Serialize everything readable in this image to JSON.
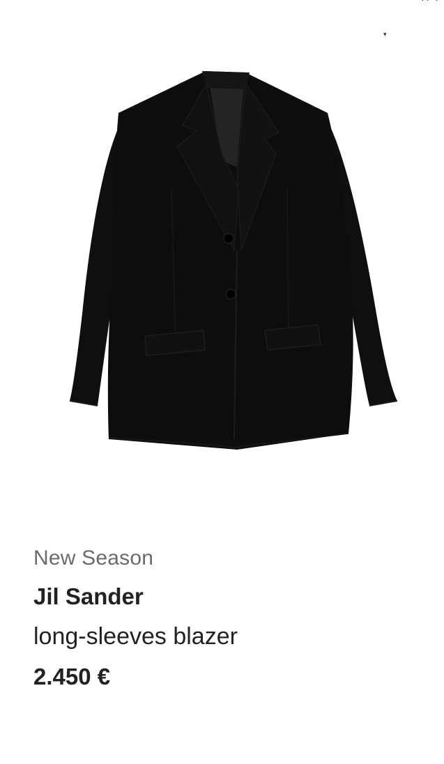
{
  "status_bar": {
    "clipped_text": "·· ·"
  },
  "image": {
    "alt": "Black single-breasted long-sleeves blazer with notch lapels and flap pockets",
    "garment_color": "#0d0d0d"
  },
  "product": {
    "badge": "New Season",
    "brand": "Jil Sander",
    "name": "long-sleeves blazer",
    "price": "2.450 €"
  },
  "icons": {
    "caret": "chevron-down-icon"
  }
}
